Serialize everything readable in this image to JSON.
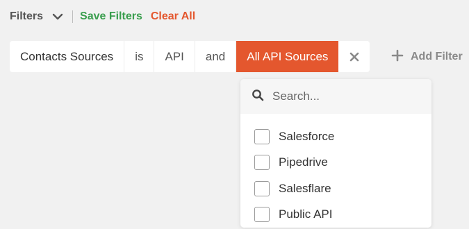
{
  "toolbar": {
    "filters_label": "Filters",
    "chevron_icon": "chevron-down-icon",
    "save_label": "Save Filters",
    "clear_label": "Clear All",
    "save_color": "#3a9e4e",
    "clear_color": "#e4572e"
  },
  "filter": {
    "field": "Contacts Sources",
    "operator": "is",
    "value": "API",
    "conjunction": "and",
    "selection": "All API Sources",
    "remove_icon": "close-icon",
    "active_color": "#e4572e"
  },
  "add_filter": {
    "icon": "plus-icon",
    "label": "Add Filter"
  },
  "dropdown": {
    "search_icon": "search-icon",
    "search_placeholder": "Search...",
    "search_value": "",
    "options": [
      {
        "label": "Salesforce",
        "checked": false
      },
      {
        "label": "Pipedrive",
        "checked": false
      },
      {
        "label": "Salesflare",
        "checked": false
      },
      {
        "label": "Public API",
        "checked": false
      }
    ]
  }
}
